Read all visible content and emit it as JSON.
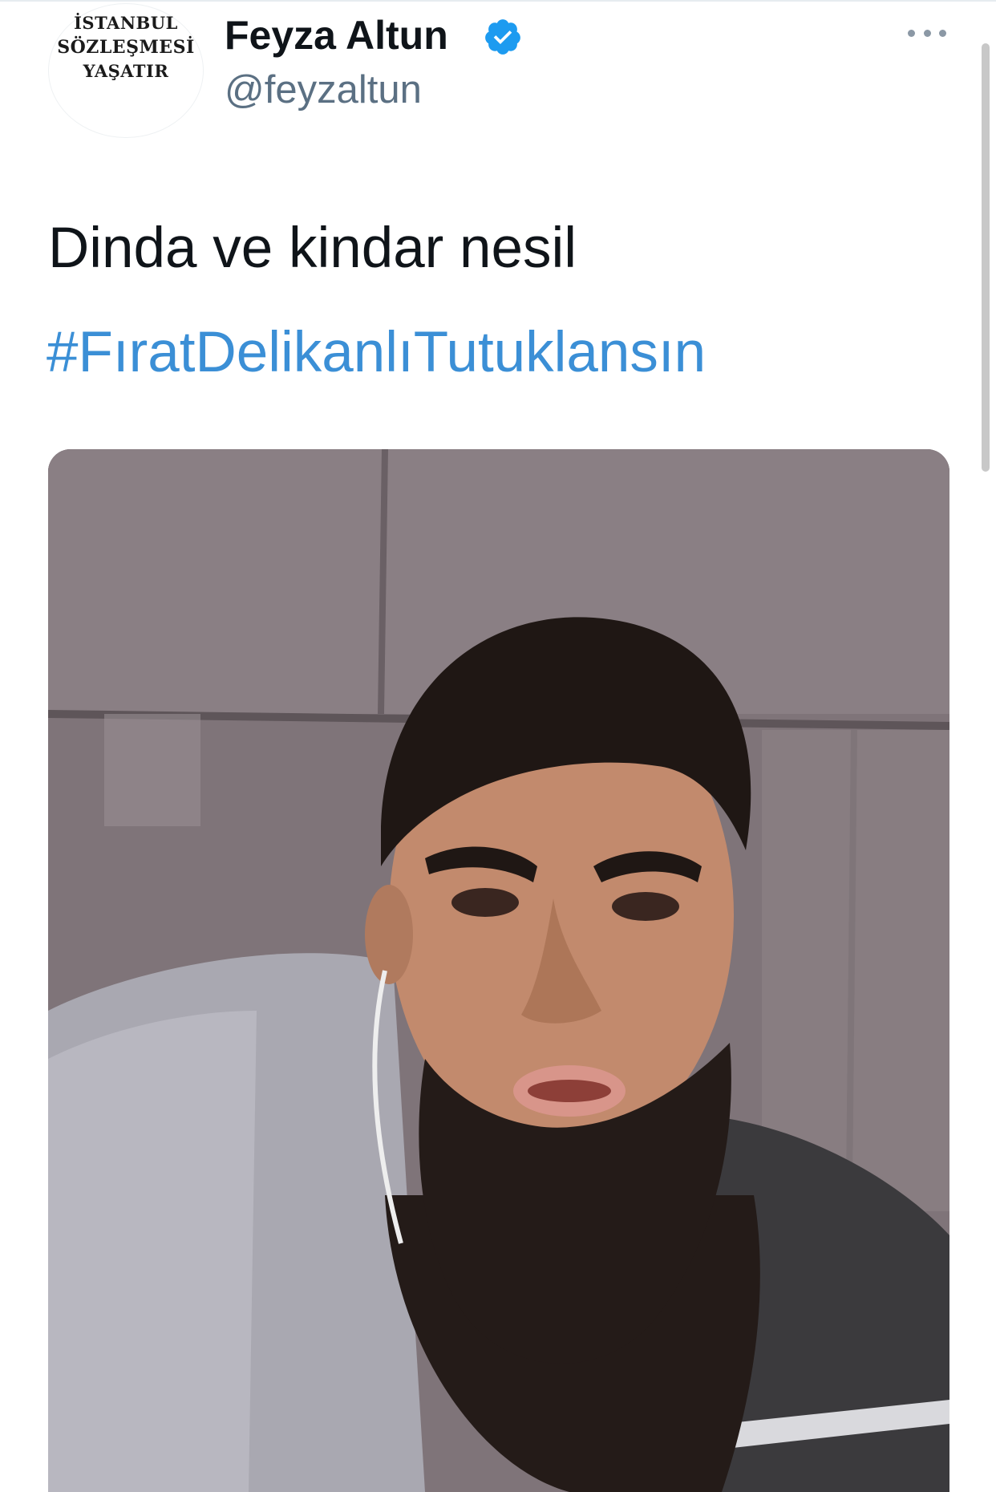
{
  "author": {
    "avatar_lines": [
      "İSTANBUL",
      "SÖZLEŞMESİ",
      "YAŞATIR"
    ],
    "display_name": "Feyza Altun",
    "handle": "@feyzaltun",
    "verified": true,
    "verified_icon": "verified-badge-icon"
  },
  "menu": {
    "icon": "more-options-icon"
  },
  "tweet": {
    "text": "Dinda ve kindar nesil",
    "hashtag": "#FıratDelikanlıTutuklansın"
  },
  "colors": {
    "link": "#3b8fd6",
    "verified": "#1d9bf0",
    "handle": "#5b7083",
    "text": "#0f1419"
  }
}
